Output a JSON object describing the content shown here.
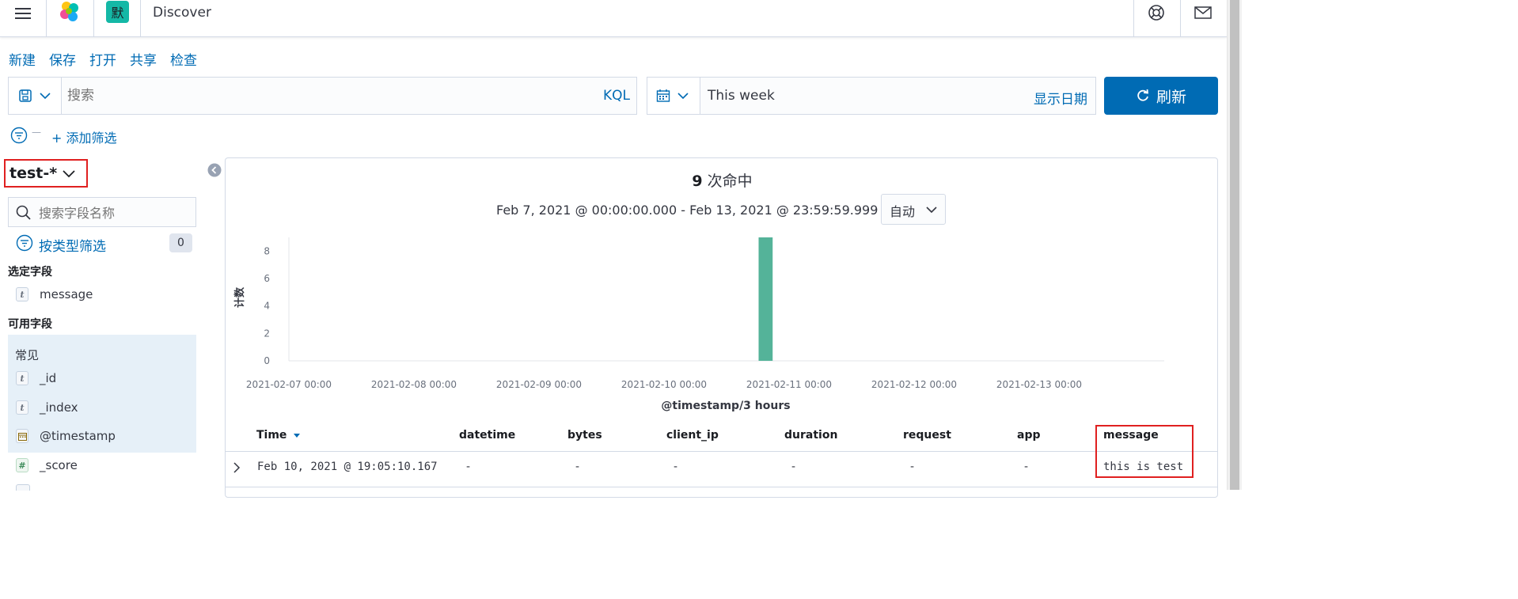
{
  "header": {
    "app_badge": "默",
    "title": "Discover"
  },
  "topnav": {
    "new": "新建",
    "save": "保存",
    "open": "打开",
    "share": "共享",
    "inspect": "检查"
  },
  "search": {
    "placeholder": "搜索",
    "language": "KQL"
  },
  "time": {
    "value": "This week",
    "show_dates": "显示日期"
  },
  "refresh_label": "刷新",
  "filter": {
    "dash": "—",
    "add": "+ 添加筛选"
  },
  "sidebar": {
    "index_pattern": "test-*",
    "field_search_placeholder": "搜索字段名称",
    "filter_by_type": "按类型筛选",
    "filter_count": "0",
    "selected_title": "选定字段",
    "selected_fields": [
      {
        "type": "t",
        "name": "message"
      }
    ],
    "available_title": "可用字段",
    "popular_title": "常见",
    "popular_fields": [
      {
        "type": "t",
        "name": "_id"
      },
      {
        "type": "t",
        "name": "_index"
      },
      {
        "type": "date",
        "name": "@timestamp"
      }
    ],
    "other_fields": [
      {
        "type": "#",
        "name": "_score"
      }
    ]
  },
  "hits": {
    "count": "9",
    "label": "次命中",
    "range": "Feb 7, 2021 @ 00:00:00.000 - Feb 13, 2021 @ 23:59:59.999",
    "interval": "自动"
  },
  "chart_data": {
    "type": "bar",
    "xlabel": "@timestamp/3 hours",
    "ylabel": "计数",
    "ylim": [
      0,
      9
    ],
    "yticks": [
      0,
      2,
      4,
      6,
      8
    ],
    "xticks": [
      "2021-02-07 00:00",
      "2021-02-08 00:00",
      "2021-02-09 00:00",
      "2021-02-10 00:00",
      "2021-02-11 00:00",
      "2021-02-12 00:00",
      "2021-02-13 00:00"
    ],
    "bars": [
      {
        "x": "2021-02-10 18:00",
        "value": 9
      }
    ],
    "color": "#54b399"
  },
  "table": {
    "columns": [
      "Time",
      "datetime",
      "bytes",
      "client_ip",
      "duration",
      "request",
      "app",
      "message"
    ],
    "rows": [
      [
        "Feb 10, 2021 @ 19:05:10.167",
        "-",
        "-",
        "-",
        "-",
        "-",
        "-",
        "this is test"
      ]
    ]
  },
  "colors": {
    "primary": "#006bb4",
    "bar": "#54b399",
    "highlight": "#e02020",
    "badge": "#14b8a6"
  }
}
